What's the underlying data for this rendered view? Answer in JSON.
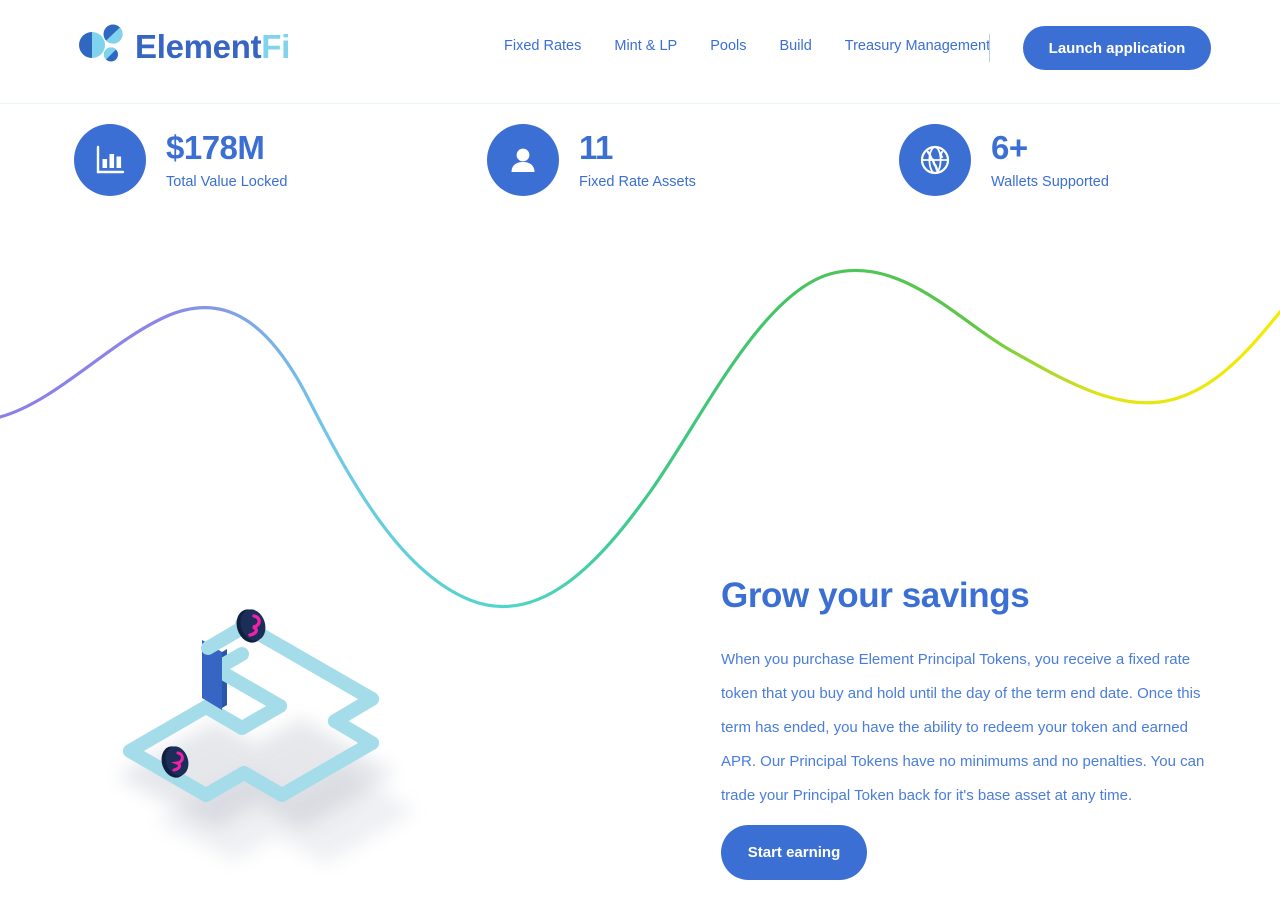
{
  "header": {
    "logo": {
      "mark_icon": "element-circles-logo-icon",
      "word_primary": "Element",
      "word_secondary": "Fi",
      "color_primary": "#3665c4",
      "color_secondary": "#7fd3ec"
    },
    "nav": [
      {
        "label": "Fixed Rates"
      },
      {
        "label": "Mint & LP"
      },
      {
        "label": "Pools"
      },
      {
        "label": "Build"
      },
      {
        "label": "Treasury Management"
      }
    ],
    "cta_label": "Launch application"
  },
  "stats": [
    {
      "icon": "bar-chart-icon",
      "value": "$178M",
      "label": "Total Value Locked"
    },
    {
      "icon": "user-icon",
      "value": "11",
      "label": "Fixed Rate Assets"
    },
    {
      "icon": "globe-icon",
      "value": "6+",
      "label": "Wallets Supported"
    }
  ],
  "hero": {
    "heading": "Grow your savings",
    "body": "When you purchase Element Principal Tokens, you receive a fixed rate token that you buy and hold until the day of the term end date. Once this term has ended, you have the ability to redeem your token and earned APR. Our Principal Tokens have no minimums and no penalties. You can trade your Principal Token back for it's base asset at any time.",
    "cta_label": "Start earning"
  },
  "illustration": {
    "name": "isometric-element-logo-illustration",
    "track_color": "#a5dcea",
    "panel_color": "#3665c4",
    "coin_body_color": "#1b2e57",
    "coin_glyph_color": "#f021a8"
  },
  "wave": {
    "name": "gradient-wave-graphic",
    "stops": [
      "#8b7fe8",
      "#6fc9e8",
      "#4fd6c9",
      "#3fc98a",
      "#46c463",
      "#a8d82a",
      "#f5ea00"
    ]
  },
  "theme": {
    "accent": "#3b6fd4",
    "text_blue": "#4a7ddb",
    "background": "#ffffff",
    "header_border": "#eaf4fb"
  }
}
